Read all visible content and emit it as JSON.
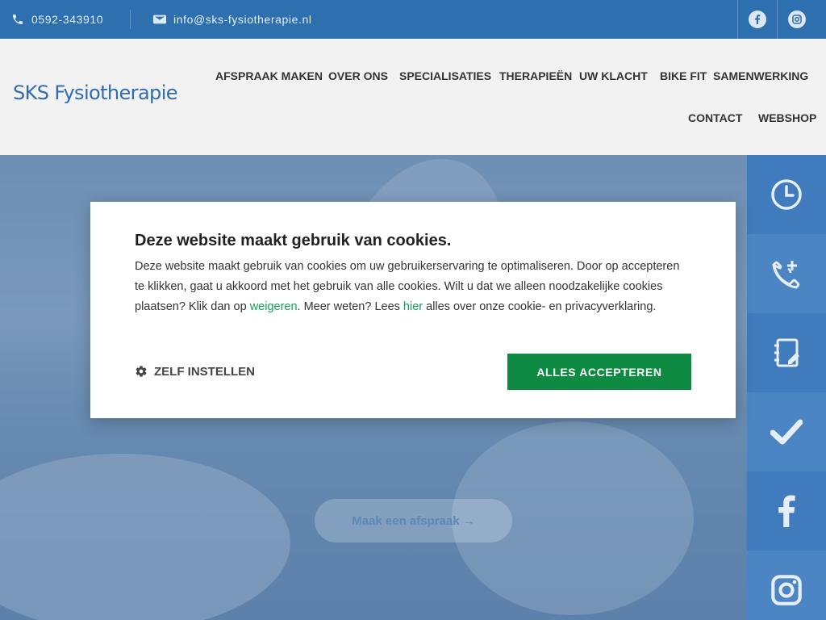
{
  "topbar": {
    "phone": "0592-343910",
    "email": "info@sks-fysiotherapie.nl",
    "social": [
      "facebook-icon",
      "instagram-icon"
    ]
  },
  "header": {
    "logo": "SKS Fysiotherapie",
    "nav": [
      "AFSPRAAK MAKEN",
      "OVER ONS",
      "SPECIALISATIES",
      "THERAPIEËN",
      "UW KLACHT",
      "BIKE FIT",
      "SAMENWERKING",
      "CONTACT",
      "WEBSHOP"
    ]
  },
  "hero": {
    "cta": "Maak een afspraak →"
  },
  "sidebar": {
    "icons": [
      "clock-icon",
      "phone-plus-icon",
      "notebook-edit-icon",
      "checkmark-icon",
      "facebook-icon",
      "instagram-icon"
    ]
  },
  "cookie": {
    "title": "Deze website maakt gebruik van cookies.",
    "text_1": "Deze website maakt gebruik van cookies om uw gebruikerservaring te optimaliseren. Door op accepteren te klikken, gaat u akkoord met het gebruik van alle cookies. Wilt u dat we alleen noodzakelijke cookies plaatsen? Klik dan op ",
    "link_refuse": "weigeren",
    "text_2": ". Meer weten? Lees ",
    "link_here": "hier",
    "text_3": " alles over onze cookie- en privacyverklaring.",
    "settings_label": "ZELF INSTELLEN",
    "accept_label": "ALLES ACCEPTEREN"
  },
  "colors": {
    "topbar": "#2e6fb0",
    "brand_blue": "#2f6db0",
    "accept_green": "#0f8a43",
    "link_green": "#13a05a"
  }
}
